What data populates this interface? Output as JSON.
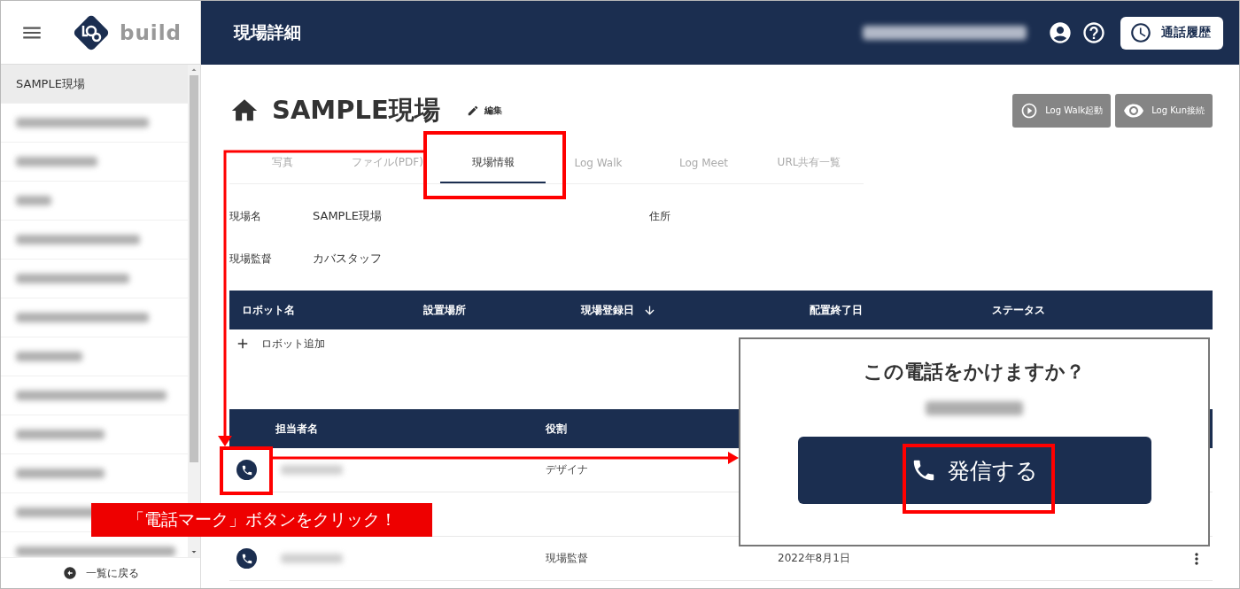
{
  "sidebar": {
    "logo_text": "build",
    "items": [
      {
        "label": "SAMPLE現場",
        "selected": true
      },
      {
        "kind": "blurred",
        "selected": false
      },
      {
        "kind": "blurred",
        "selected": false
      },
      {
        "kind": "blurred",
        "selected": false
      },
      {
        "kind": "blurred",
        "selected": false
      },
      {
        "kind": "blurred",
        "selected": false
      },
      {
        "kind": "blurred",
        "selected": false
      },
      {
        "kind": "blurred",
        "selected": false
      },
      {
        "kind": "blurred",
        "selected": false
      },
      {
        "kind": "blurred",
        "selected": false
      },
      {
        "kind": "blurred",
        "selected": false
      },
      {
        "kind": "blurred",
        "selected": false
      },
      {
        "kind": "blurred",
        "selected": false
      }
    ],
    "back_link": "一覧に戻る"
  },
  "header": {
    "title": "現場詳細",
    "account_blurred": true,
    "history_button": "通話履歴"
  },
  "site": {
    "name": "SAMPLE現場",
    "edit": "編集",
    "actions": [
      {
        "label": "Log Walk起動",
        "kind": "play"
      },
      {
        "label": "Log Kun接続",
        "kind": "eye"
      }
    ]
  },
  "tabs": [
    {
      "label": "写真",
      "selected": false
    },
    {
      "label": "ファイル(PDF)",
      "selected": false
    },
    {
      "label": "現場情報",
      "selected": true
    },
    {
      "label": "Log Walk",
      "selected": false
    },
    {
      "label": "Log Meet",
      "selected": false
    },
    {
      "label": "URL共有一覧",
      "selected": false
    }
  ],
  "fields": [
    {
      "label": "現場名",
      "value": "SAMPLE現場"
    },
    {
      "label": "住所"
    },
    {
      "label": "現場監督",
      "value": "カバスタッフ"
    }
  ],
  "robot_table": {
    "columns": [
      {
        "label": "ロボット名",
        "sorted": false
      },
      {
        "label": "設置場所",
        "sorted": false
      },
      {
        "label": "現場登録日",
        "sorted": true
      },
      {
        "label": "配置終了日",
        "sorted": false
      },
      {
        "label": "ステータス",
        "sorted": false
      }
    ],
    "add_label": "ロボット追加"
  },
  "staff_table": {
    "columns": [
      "担当者名",
      "役割"
    ],
    "rows": [
      {
        "phone": true,
        "name_blurred": true,
        "role": "デザイナ"
      },
      {
        "phone": false,
        "name_blurred": false
      },
      {
        "phone": true,
        "name_blurred": true,
        "role": "現場監督",
        "date": "2022年8月1日",
        "menu": true
      }
    ]
  },
  "dialog": {
    "title": "この電話をかけますか？",
    "subtitle_blurred": true,
    "call_button": "発信する"
  },
  "annotation": {
    "callout": "「電話マーク」ボタンをクリック！"
  }
}
